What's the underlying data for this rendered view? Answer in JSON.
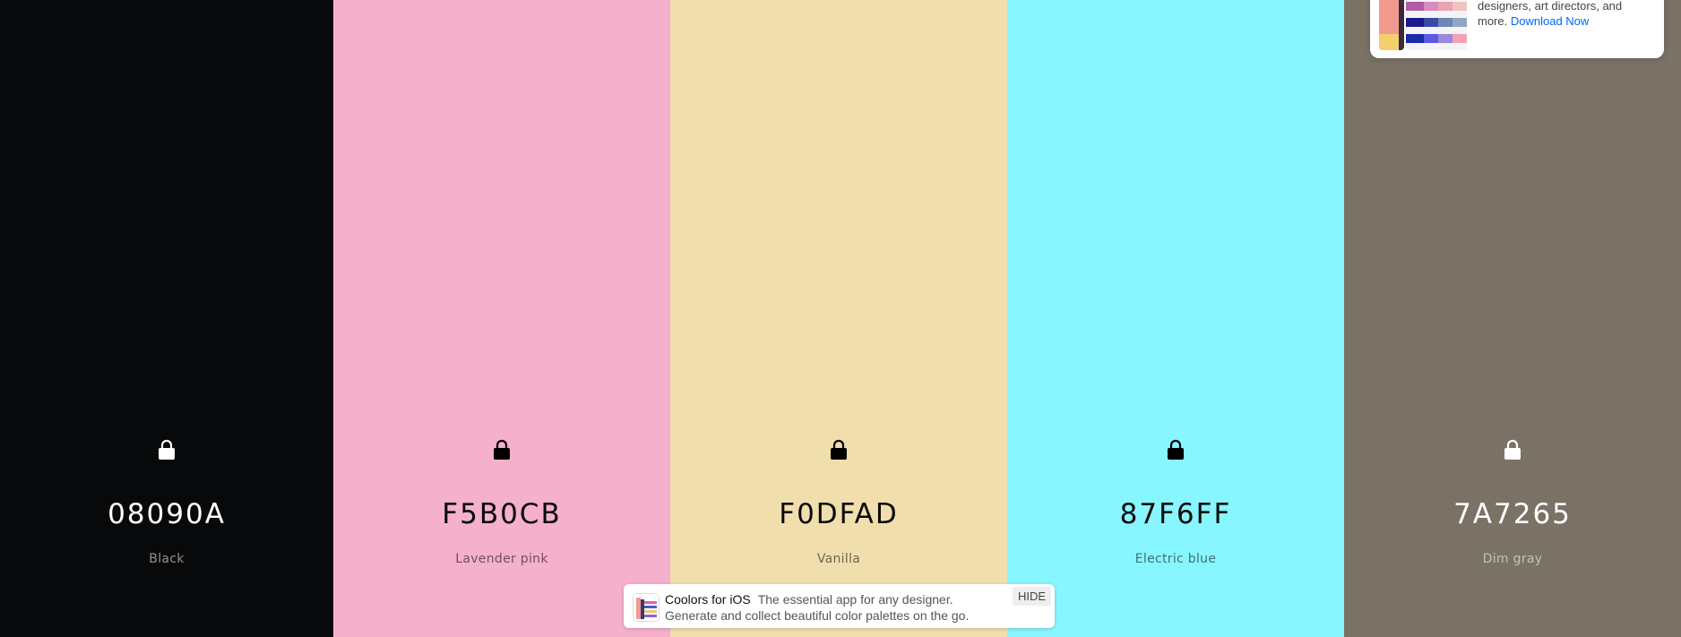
{
  "palette": {
    "colors": [
      {
        "hex": "08090A",
        "name": "Black",
        "bg": "#08090A",
        "tone": "dark"
      },
      {
        "hex": "F5B0CB",
        "name": "Lavender pink",
        "bg": "#F5B0CB",
        "tone": "light"
      },
      {
        "hex": "F0DFAD",
        "name": "Vanilla",
        "bg": "#F0DFAD",
        "tone": "light"
      },
      {
        "hex": "87F6FF",
        "name": "Electric blue",
        "bg": "#87F6FF",
        "tone": "light"
      },
      {
        "hex": "7A7265",
        "name": "Dim gray",
        "bg": "#7A7265",
        "tone": "dark"
      }
    ]
  },
  "ad": {
    "text_line1": "designers, art directors, and",
    "text_line2": "more.",
    "link": "Download Now",
    "link_color": "#0066ff"
  },
  "banner": {
    "title": "Coolors for iOS",
    "tagline": "The essential app for any designer.",
    "subtitle": "Generate and collect beautiful color palettes on the go.",
    "hide_label": "HIDE"
  },
  "icons": {
    "lock": "lock-icon"
  }
}
